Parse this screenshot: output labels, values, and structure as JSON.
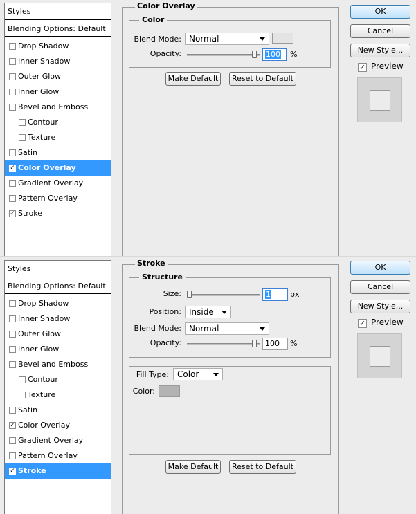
{
  "panel1": {
    "styles_title": "Styles",
    "blending_options": "Blending Options: Default",
    "items": [
      {
        "label": "Drop Shadow",
        "checked": false,
        "selected": false,
        "sub": false
      },
      {
        "label": "Inner Shadow",
        "checked": false,
        "selected": false,
        "sub": false
      },
      {
        "label": "Outer Glow",
        "checked": false,
        "selected": false,
        "sub": false
      },
      {
        "label": "Inner Glow",
        "checked": false,
        "selected": false,
        "sub": false
      },
      {
        "label": "Bevel and Emboss",
        "checked": false,
        "selected": false,
        "sub": false
      },
      {
        "label": "Contour",
        "checked": false,
        "selected": false,
        "sub": true
      },
      {
        "label": "Texture",
        "checked": false,
        "selected": false,
        "sub": true
      },
      {
        "label": "Satin",
        "checked": false,
        "selected": false,
        "sub": false
      },
      {
        "label": "Color Overlay",
        "checked": true,
        "selected": true,
        "sub": false
      },
      {
        "label": "Gradient Overlay",
        "checked": false,
        "selected": false,
        "sub": false
      },
      {
        "label": "Pattern Overlay",
        "checked": false,
        "selected": false,
        "sub": false
      },
      {
        "label": "Stroke",
        "checked": true,
        "selected": false,
        "sub": false
      }
    ],
    "section_title": "Color Overlay",
    "group_title": "Color",
    "blend_mode_label": "Blend Mode:",
    "blend_mode_value": "Normal",
    "overlay_color": "#e4e4e4",
    "opacity_label": "Opacity:",
    "opacity_value": "100",
    "opacity_unit": "%",
    "make_default": "Make Default",
    "reset_default": "Reset to Default",
    "ok": "OK",
    "cancel": "Cancel",
    "new_style": "New Style...",
    "preview": "Preview",
    "preview_checked": true
  },
  "panel2": {
    "styles_title": "Styles",
    "blending_options": "Blending Options: Default",
    "items": [
      {
        "label": "Drop Shadow",
        "checked": false,
        "selected": false,
        "sub": false
      },
      {
        "label": "Inner Shadow",
        "checked": false,
        "selected": false,
        "sub": false
      },
      {
        "label": "Outer Glow",
        "checked": false,
        "selected": false,
        "sub": false
      },
      {
        "label": "Inner Glow",
        "checked": false,
        "selected": false,
        "sub": false
      },
      {
        "label": "Bevel and Emboss",
        "checked": false,
        "selected": false,
        "sub": false
      },
      {
        "label": "Contour",
        "checked": false,
        "selected": false,
        "sub": true
      },
      {
        "label": "Texture",
        "checked": false,
        "selected": false,
        "sub": true
      },
      {
        "label": "Satin",
        "checked": false,
        "selected": false,
        "sub": false
      },
      {
        "label": "Color Overlay",
        "checked": true,
        "selected": false,
        "sub": false
      },
      {
        "label": "Gradient Overlay",
        "checked": false,
        "selected": false,
        "sub": false
      },
      {
        "label": "Pattern Overlay",
        "checked": false,
        "selected": false,
        "sub": false
      },
      {
        "label": "Stroke",
        "checked": true,
        "selected": true,
        "sub": false
      }
    ],
    "section_title": "Stroke",
    "group_title": "Structure",
    "size_label": "Size:",
    "size_value": "1",
    "size_unit": "px",
    "position_label": "Position:",
    "position_value": "Inside",
    "blend_mode_label": "Blend Mode:",
    "blend_mode_value": "Normal",
    "opacity_label": "Opacity:",
    "opacity_value": "100",
    "opacity_unit": "%",
    "fill_type_label": "Fill Type:",
    "fill_type_value": "Color",
    "color_label": "Color:",
    "stroke_color": "#b3b3b3",
    "make_default": "Make Default",
    "reset_default": "Reset to Default",
    "ok": "OK",
    "cancel": "Cancel",
    "new_style": "New Style...",
    "preview": "Preview",
    "preview_checked": true
  }
}
